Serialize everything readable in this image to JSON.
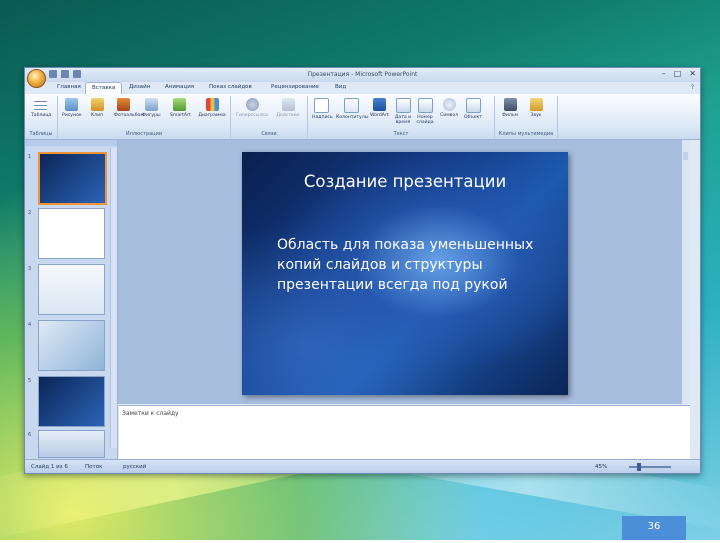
{
  "window": {
    "title": "Презентация - Microsoft PowerPoint",
    "controls": [
      "–",
      "□",
      "✕"
    ]
  },
  "ribbon": {
    "tabs": [
      "Главная",
      "Вставка",
      "Дизайн",
      "Анимация",
      "Показ слайдов",
      "Рецензирование",
      "Вид"
    ],
    "active_tab": "Вставка",
    "groups": [
      {
        "label": "Таблицы",
        "buttons": [
          "Таблица"
        ]
      },
      {
        "label": "Иллюстрации",
        "buttons": [
          "Рисунок",
          "Клип",
          "Фотоальбом",
          "Фигуры",
          "SmartArt",
          "Диаграмма"
        ]
      },
      {
        "label": "Связи",
        "buttons": [
          "Гиперссылка",
          "Действие"
        ]
      },
      {
        "label": "Текст",
        "buttons": [
          "Надпись",
          "Колонтитулы",
          "WordArt",
          "Дата и время",
          "Номер слайда",
          "Символ",
          "Объект"
        ]
      },
      {
        "label": "Клипы мультимедиа",
        "buttons": [
          "Фильм",
          "Звук"
        ]
      }
    ]
  },
  "slide": {
    "title": "Создание презентации",
    "body": "Область для показа уменьшенных копий слайдов и структуры презентации всегда под рукой"
  },
  "notes": {
    "placeholder": "Заметки к слайду"
  },
  "statusbar": {
    "slide_info": "Слайд 1 из 6",
    "theme": "Поток",
    "language": "русский",
    "zoom": "45%"
  },
  "page_number": "36",
  "colors": {
    "accent": "#f29436",
    "ribbon": "#dde9f7",
    "slide_bg": "#143e8a"
  }
}
